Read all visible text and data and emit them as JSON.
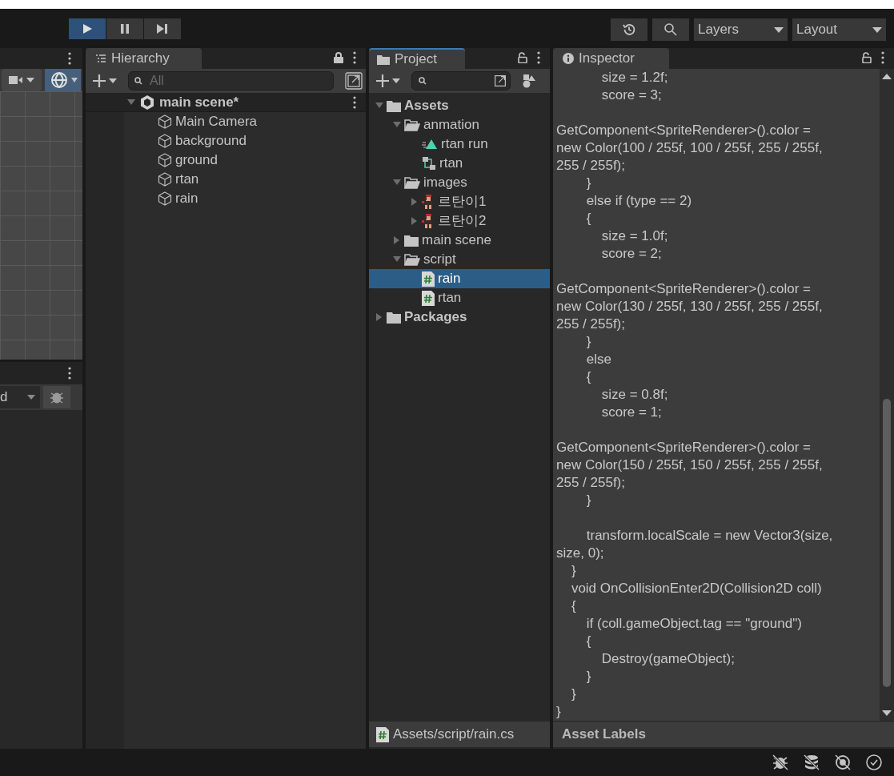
{
  "toolbar": {
    "play_active": true,
    "layers_label": "Layers",
    "layout_label": "Layout"
  },
  "scene_panel": {
    "console_filter": "d"
  },
  "hierarchy": {
    "title": "Hierarchy",
    "search_placeholder": "All",
    "scene": {
      "label": "main scene*",
      "expanded": true,
      "children": [
        {
          "label": "Main Camera"
        },
        {
          "label": "background"
        },
        {
          "label": "ground"
        },
        {
          "label": "rtan"
        },
        {
          "label": "rain"
        }
      ]
    }
  },
  "project": {
    "title": "Project",
    "tree": [
      {
        "label": "Assets",
        "kind": "root",
        "expanded": true,
        "selected": false,
        "children": [
          {
            "label": "anmation",
            "kind": "folder",
            "expanded": true,
            "selected": false,
            "children": [
              {
                "label": "rtan run",
                "kind": "animation",
                "selected": false
              },
              {
                "label": "rtan",
                "kind": "controller",
                "selected": false
              }
            ]
          },
          {
            "label": "images",
            "kind": "folder",
            "expanded": true,
            "selected": false,
            "children": [
              {
                "label": "르탄이1",
                "kind": "sprite",
                "expanded": false,
                "selected": false
              },
              {
                "label": "르탄이2",
                "kind": "sprite",
                "expanded": false,
                "selected": false
              }
            ]
          },
          {
            "label": "main scene",
            "kind": "folder",
            "expanded": false,
            "selected": false
          },
          {
            "label": "script",
            "kind": "folder",
            "expanded": true,
            "selected": false,
            "children": [
              {
                "label": "rain",
                "kind": "script",
                "selected": true
              },
              {
                "label": "rtan",
                "kind": "script",
                "selected": false
              }
            ]
          }
        ]
      },
      {
        "label": "Packages",
        "kind": "root",
        "expanded": false,
        "selected": false
      }
    ],
    "footer_path": "Assets/script/rain.cs"
  },
  "inspector": {
    "title": "Inspector",
    "code": "            size = 1.2f;\n            score = 3;\n\nGetComponent<SpriteRenderer>().color =\nnew Color(100 / 255f, 100 / 255f, 255 / 255f,\n255 / 255f);\n        }\n        else if (type == 2)\n        {\n            size = 1.0f;\n            score = 2;\n\nGetComponent<SpriteRenderer>().color =\nnew Color(130 / 255f, 130 / 255f, 255 / 255f,\n255 / 255f);\n        }\n        else\n        {\n            size = 0.8f;\n            score = 1;\n\nGetComponent<SpriteRenderer>().color =\nnew Color(150 / 255f, 150 / 255f, 255 / 255f,\n255 / 255f);\n        }\n\n        transform.localScale = new Vector3(size,\nsize, 0);\n    }\n    void OnCollisionEnter2D(Collision2D coll)\n    {\n        if (coll.gameObject.tag == \"ground\")\n        {\n            Destroy(gameObject);\n        }\n    }\n}",
    "footer": "Asset Labels"
  }
}
